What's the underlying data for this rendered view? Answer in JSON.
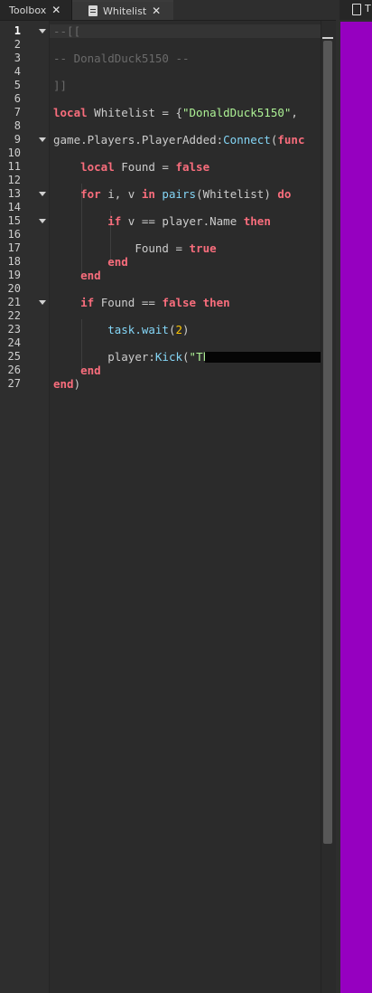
{
  "tabs": [
    {
      "label": "Toolbox",
      "close": "✕"
    },
    {
      "label": "Whitelist",
      "close": "✕"
    }
  ],
  "right_panel": {
    "tab_label": "T"
  },
  "editor": {
    "current_line": 1,
    "line_numbers": [
      "1",
      "2",
      "3",
      "4",
      "5",
      "6",
      "7",
      "8",
      "9",
      "10",
      "11",
      "12",
      "13",
      "14",
      "15",
      "16",
      "17",
      "18",
      "19",
      "20",
      "21",
      "22",
      "23",
      "24",
      "25",
      "26",
      "27"
    ],
    "code": {
      "l1": "--[[",
      "l3": "-- DonaldDuck5150 --",
      "l5": "]]",
      "l7_kw": "local",
      "l7_a": " Whitelist = {",
      "l7_str": "\"DonaldDuck5150\"",
      "l7_b": ",",
      "l9_a": "game.Players.PlayerAdded:",
      "l9_fn": "Connect",
      "l9_b": "(",
      "l9_kw": "func",
      "l11_kw": "local",
      "l11_a": " Found = ",
      "l11_kw2": "false",
      "l13_kw": "for",
      "l13_a": " i, v ",
      "l13_kw2": "in",
      "l13_fn": " pairs",
      "l13_b": "(Whitelist) ",
      "l13_kw3": "do",
      "l15_kw": "if",
      "l15_a": " v == player.Name ",
      "l15_kw2": "then",
      "l17_a": "Found = ",
      "l17_kw": "true",
      "l18_kw": "end",
      "l19_kw": "end",
      "l21_kw": "if",
      "l21_a": " Found == ",
      "l21_kw2": "false",
      "l21_kw3": " then",
      "l23_fn": "task.wait",
      "l23_a": "(",
      "l23_num": "2",
      "l23_b": ")",
      "l25_a": "player:",
      "l25_fn": "Kick",
      "l25_b": "(",
      "l25_str": "\"Th",
      "l26_kw": "end",
      "l27_kw": "end",
      "l27_a": ")"
    }
  },
  "colors": {
    "keyword": "#f86d7c",
    "comment": "#6a6a6a",
    "string": "#adf195",
    "function": "#84d6f7",
    "number": "#ffc600",
    "accent_panel": "#9600c0"
  }
}
